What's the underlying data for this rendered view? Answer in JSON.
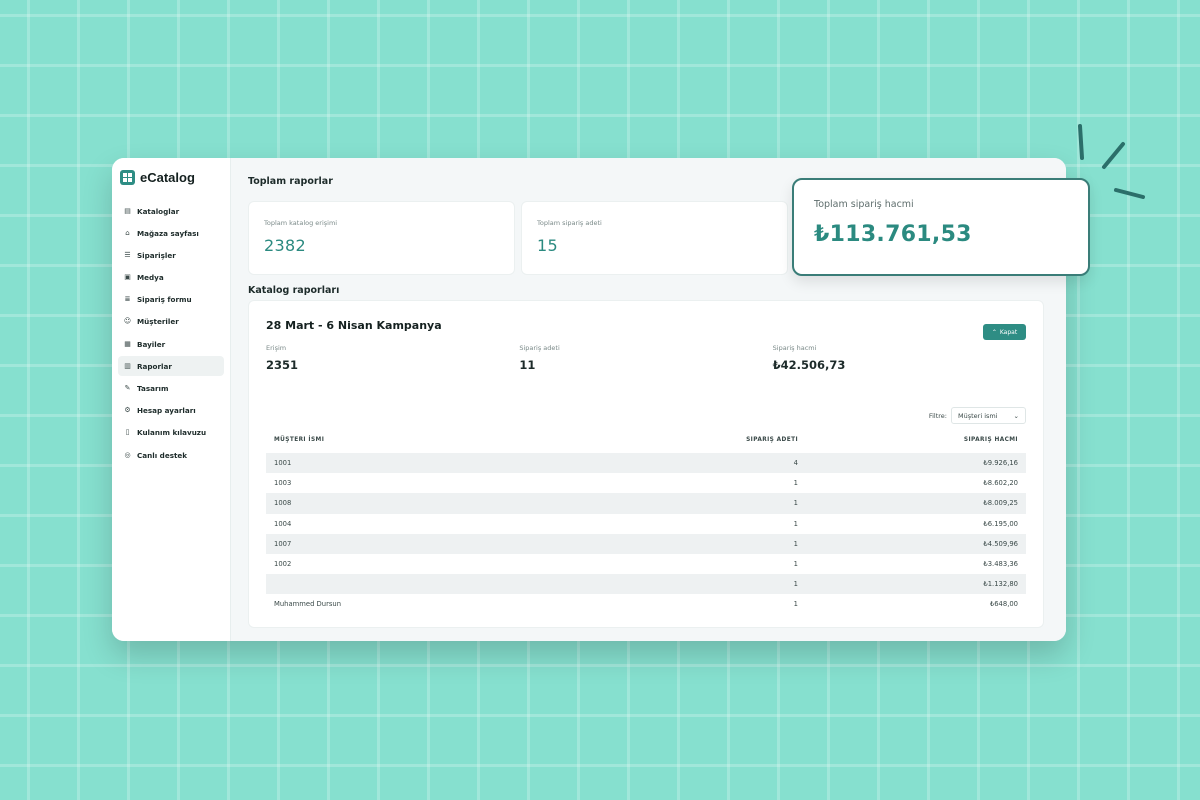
{
  "app": {
    "name": "eCatalog"
  },
  "sidebar": {
    "items": [
      {
        "label": "Kataloglar",
        "icon": "book-icon"
      },
      {
        "label": "Mağaza sayfası",
        "icon": "store-icon"
      },
      {
        "label": "Siparişler",
        "icon": "orders-icon"
      },
      {
        "label": "Medya",
        "icon": "image-icon"
      },
      {
        "label": "Sipariş formu",
        "icon": "form-icon"
      },
      {
        "label": "Müşteriler",
        "icon": "users-icon"
      },
      {
        "label": "Bayiler",
        "icon": "dealers-icon"
      },
      {
        "label": "Raporlar",
        "icon": "report-icon",
        "active": true
      },
      {
        "label": "Tasarım",
        "icon": "brush-icon"
      },
      {
        "label": "Hesap ayarları",
        "icon": "settings-icon"
      },
      {
        "label": "Kulanım kılavuzu",
        "icon": "guide-icon"
      },
      {
        "label": "Canlı destek",
        "icon": "support-icon"
      }
    ]
  },
  "totals": {
    "title": "Toplam raporlar",
    "cards": [
      {
        "label": "Toplam katalog erişimi",
        "value": "2382"
      },
      {
        "label": "Toplam sipariş adeti",
        "value": "15"
      }
    ],
    "highlight": {
      "label": "Toplam sipariş hacmi",
      "value": "₺113.761,53"
    }
  },
  "catalog": {
    "title": "Katalog raporları",
    "campaign": {
      "name": "28 Mart - 6 Nisan Kampanya",
      "close_label": "Kapat",
      "metrics": [
        {
          "label": "Erişim",
          "value": "2351"
        },
        {
          "label": "Sipariş adeti",
          "value": "11"
        },
        {
          "label": "Sipariş hacmi",
          "value": "₺42.506,73"
        }
      ],
      "filter": {
        "label": "Filtre:",
        "selected": "Müşteri ismi"
      },
      "table": {
        "headers": [
          "MÜŞTERI İSMI",
          "SIPARIŞ ADETI",
          "SIPARIŞ HACMI"
        ],
        "rows": [
          [
            "1001",
            "4",
            "₺9.926,16"
          ],
          [
            "1003",
            "1",
            "₺8.602,20"
          ],
          [
            "1008",
            "1",
            "₺8.009,25"
          ],
          [
            "1004",
            "1",
            "₺6.195,00"
          ],
          [
            "1007",
            "1",
            "₺4.509,96"
          ],
          [
            "1002",
            "1",
            "₺3.483,36"
          ],
          [
            "",
            "1",
            "₺1.132,80"
          ],
          [
            "Muhammed Dursun",
            "1",
            "₺648,00"
          ]
        ]
      }
    }
  },
  "colors": {
    "background": "#86e0cf",
    "accent": "#2e8d84",
    "value_teal": "#2b8a80",
    "highlight_border": "#3a7d78"
  }
}
